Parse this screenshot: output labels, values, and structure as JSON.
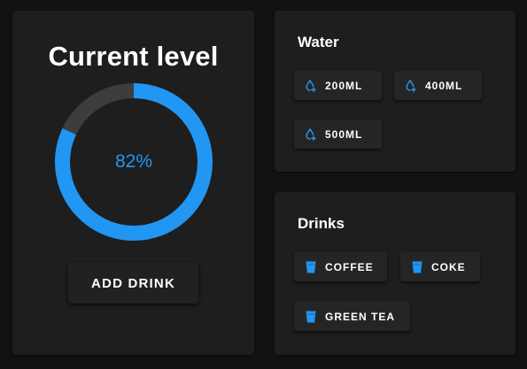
{
  "level": {
    "title": "Current level",
    "percent_text": "82%",
    "percent_value": 0.82,
    "add_button_label": "ADD DRINK",
    "colors": {
      "fill": "#2196f3",
      "track": "#3d3d3d"
    }
  },
  "water": {
    "title": "Water",
    "items": [
      {
        "label": "200ML",
        "icon": "water-drop-plus-icon"
      },
      {
        "label": "400ML",
        "icon": "water-drop-plus-icon"
      },
      {
        "label": "500ML",
        "icon": "water-drop-plus-icon"
      }
    ]
  },
  "drinks": {
    "title": "Drinks",
    "items": [
      {
        "label": "COFFEE",
        "icon": "cup-icon"
      },
      {
        "label": "COKE",
        "icon": "cup-icon"
      },
      {
        "label": "GREEN TEA",
        "icon": "cup-icon"
      }
    ]
  },
  "theme": {
    "background": "#121212",
    "card": "#1e1e1e",
    "accent": "#2196f3"
  }
}
